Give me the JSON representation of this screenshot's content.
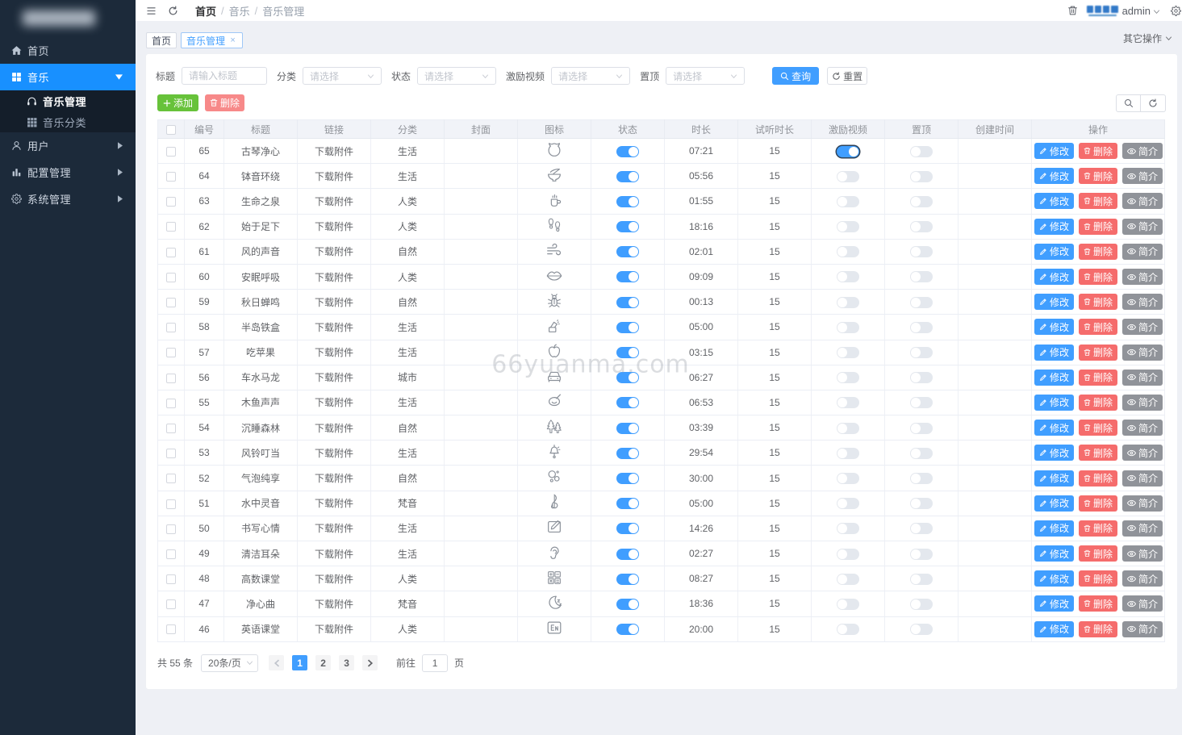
{
  "sidebar": {
    "items": [
      {
        "label": "首页",
        "icon": "home-icon",
        "active": false,
        "caret": null
      },
      {
        "label": "音乐",
        "icon": "music-grid-icon",
        "active": true,
        "caret": "down",
        "children": [
          {
            "label": "音乐管理",
            "icon": "headset-icon",
            "active": true
          },
          {
            "label": "音乐分类",
            "icon": "category-grid-icon",
            "active": false
          }
        ]
      },
      {
        "label": "用户",
        "icon": "user-icon",
        "active": false,
        "caret": "right"
      },
      {
        "label": "配置管理",
        "icon": "bar-chart-icon",
        "active": false,
        "caret": "right"
      },
      {
        "label": "系统管理",
        "icon": "gear-icon",
        "active": false,
        "caret": "right"
      }
    ]
  },
  "navbar": {
    "breadcrumb": [
      "首页",
      "音乐",
      "音乐管理"
    ],
    "username": "admin"
  },
  "tags_bar": {
    "tabs": [
      {
        "label": "首页",
        "active": false,
        "closable": false
      },
      {
        "label": "音乐管理",
        "active": true,
        "closable": true
      }
    ],
    "more_label": "其它操作"
  },
  "filters": {
    "fields": [
      {
        "label": "标题",
        "type": "input",
        "placeholder": "请输入标题"
      },
      {
        "label": "分类",
        "type": "select",
        "placeholder": "请选择"
      },
      {
        "label": "状态",
        "type": "select",
        "placeholder": "请选择"
      },
      {
        "label": "激励视频",
        "type": "select",
        "placeholder": "请选择"
      },
      {
        "label": "置顶",
        "type": "select",
        "placeholder": "请选择"
      }
    ],
    "query_label": "查询",
    "reset_label": "重置"
  },
  "toolbar": {
    "add_label": "添加",
    "delete_label": "删除"
  },
  "table": {
    "columns": [
      "编号",
      "标题",
      "链接",
      "分类",
      "封面",
      "图标",
      "状态",
      "时长",
      "试听时长",
      "激励视频",
      "置顶",
      "创建时间",
      "操作"
    ],
    "action_labels": {
      "edit": "修改",
      "delete": "删除",
      "intro": "简介"
    },
    "rows": [
      {
        "id": 65,
        "title": "古琴净心",
        "link": "下载附件",
        "category": "生活",
        "icon": "guqin-icon",
        "status": true,
        "duration": "07:21",
        "preview": 15,
        "reward": true,
        "reward_focus": true,
        "top": false,
        "created": ""
      },
      {
        "id": 64,
        "title": "钵音环绕",
        "link": "下载附件",
        "category": "生活",
        "icon": "bowl-icon",
        "status": true,
        "duration": "05:56",
        "preview": 15,
        "reward": false,
        "top": false,
        "created": ""
      },
      {
        "id": 63,
        "title": "生命之泉",
        "link": "下载附件",
        "category": "人类",
        "icon": "fountain-icon",
        "status": true,
        "duration": "01:55",
        "preview": 15,
        "reward": false,
        "top": false,
        "created": ""
      },
      {
        "id": 62,
        "title": "始于足下",
        "link": "下载附件",
        "category": "人类",
        "icon": "footsteps-icon",
        "status": true,
        "duration": "18:16",
        "preview": 15,
        "reward": false,
        "top": false,
        "created": ""
      },
      {
        "id": 61,
        "title": "风的声音",
        "link": "下载附件",
        "category": "自然",
        "icon": "wind-icon",
        "status": true,
        "duration": "02:01",
        "preview": 15,
        "reward": false,
        "top": false,
        "created": ""
      },
      {
        "id": 60,
        "title": "安眠呼吸",
        "link": "下载附件",
        "category": "人类",
        "icon": "lips-icon",
        "status": true,
        "duration": "09:09",
        "preview": 15,
        "reward": false,
        "top": false,
        "created": ""
      },
      {
        "id": 59,
        "title": "秋日蝉鸣",
        "link": "下载附件",
        "category": "自然",
        "icon": "cicada-icon",
        "status": true,
        "duration": "00:13",
        "preview": 15,
        "reward": false,
        "top": false,
        "created": ""
      },
      {
        "id": 58,
        "title": "半岛铁盒",
        "link": "下载附件",
        "category": "生活",
        "icon": "music-box-icon",
        "status": true,
        "duration": "05:00",
        "preview": 15,
        "reward": false,
        "top": false,
        "created": ""
      },
      {
        "id": 57,
        "title": "吃苹果",
        "link": "下载附件",
        "category": "生活",
        "icon": "apple-icon",
        "status": true,
        "duration": "03:15",
        "preview": 15,
        "reward": false,
        "top": false,
        "created": ""
      },
      {
        "id": 56,
        "title": "车水马龙",
        "link": "下载附件",
        "category": "城市",
        "icon": "car-icon",
        "status": true,
        "duration": "06:27",
        "preview": 15,
        "reward": false,
        "top": false,
        "created": ""
      },
      {
        "id": 55,
        "title": "木鱼声声",
        "link": "下载附件",
        "category": "生活",
        "icon": "wooden-fish-icon",
        "status": true,
        "duration": "06:53",
        "preview": 15,
        "reward": false,
        "top": false,
        "created": ""
      },
      {
        "id": 54,
        "title": "沉睡森林",
        "link": "下载附件",
        "category": "自然",
        "icon": "forest-icon",
        "status": true,
        "duration": "03:39",
        "preview": 15,
        "reward": false,
        "top": false,
        "created": ""
      },
      {
        "id": 53,
        "title": "风铃叮当",
        "link": "下载附件",
        "category": "生活",
        "icon": "wind-chime-icon",
        "status": true,
        "duration": "29:54",
        "preview": 15,
        "reward": false,
        "top": false,
        "created": ""
      },
      {
        "id": 52,
        "title": "气泡纯享",
        "link": "下载附件",
        "category": "自然",
        "icon": "bubbles-icon",
        "status": true,
        "duration": "30:00",
        "preview": 15,
        "reward": false,
        "top": false,
        "created": ""
      },
      {
        "id": 51,
        "title": "水中灵音",
        "link": "下载附件",
        "category": "梵音",
        "icon": "treble-clef-icon",
        "status": true,
        "duration": "05:00",
        "preview": 15,
        "reward": false,
        "top": false,
        "created": ""
      },
      {
        "id": 50,
        "title": "书写心情",
        "link": "下载附件",
        "category": "生活",
        "icon": "writing-icon",
        "status": true,
        "duration": "14:26",
        "preview": 15,
        "reward": false,
        "top": false,
        "created": ""
      },
      {
        "id": 49,
        "title": "清洁耳朵",
        "link": "下载附件",
        "category": "生活",
        "icon": "ear-icon",
        "status": true,
        "duration": "02:27",
        "preview": 15,
        "reward": false,
        "top": false,
        "created": ""
      },
      {
        "id": 48,
        "title": "高数课堂",
        "link": "下载附件",
        "category": "人类",
        "icon": "math-icon",
        "status": true,
        "duration": "08:27",
        "preview": 15,
        "reward": false,
        "top": false,
        "created": ""
      },
      {
        "id": 47,
        "title": "净心曲",
        "link": "下载附件",
        "category": "梵音",
        "icon": "moon-icon",
        "status": true,
        "duration": "18:36",
        "preview": 15,
        "reward": false,
        "top": false,
        "created": ""
      },
      {
        "id": 46,
        "title": "英语课堂",
        "link": "下载附件",
        "category": "人类",
        "icon": "english-icon",
        "status": true,
        "duration": "20:00",
        "preview": 15,
        "reward": false,
        "top": false,
        "created": ""
      }
    ]
  },
  "pagination": {
    "total_label": "共 55 条",
    "page_size_label": "20条/页",
    "pages": [
      "1",
      "2",
      "3"
    ],
    "active_page": "1",
    "goto_label": "前往",
    "goto_value": "1",
    "page_unit_label": "页"
  },
  "watermark": "66yuanma.com",
  "colors": {
    "primary": "#409eff",
    "success": "#67c23a",
    "danger": "#f56c6c",
    "info": "#909399",
    "sidebar_bg": "#1c2a3a",
    "sidebar_active": "#1890ff"
  }
}
